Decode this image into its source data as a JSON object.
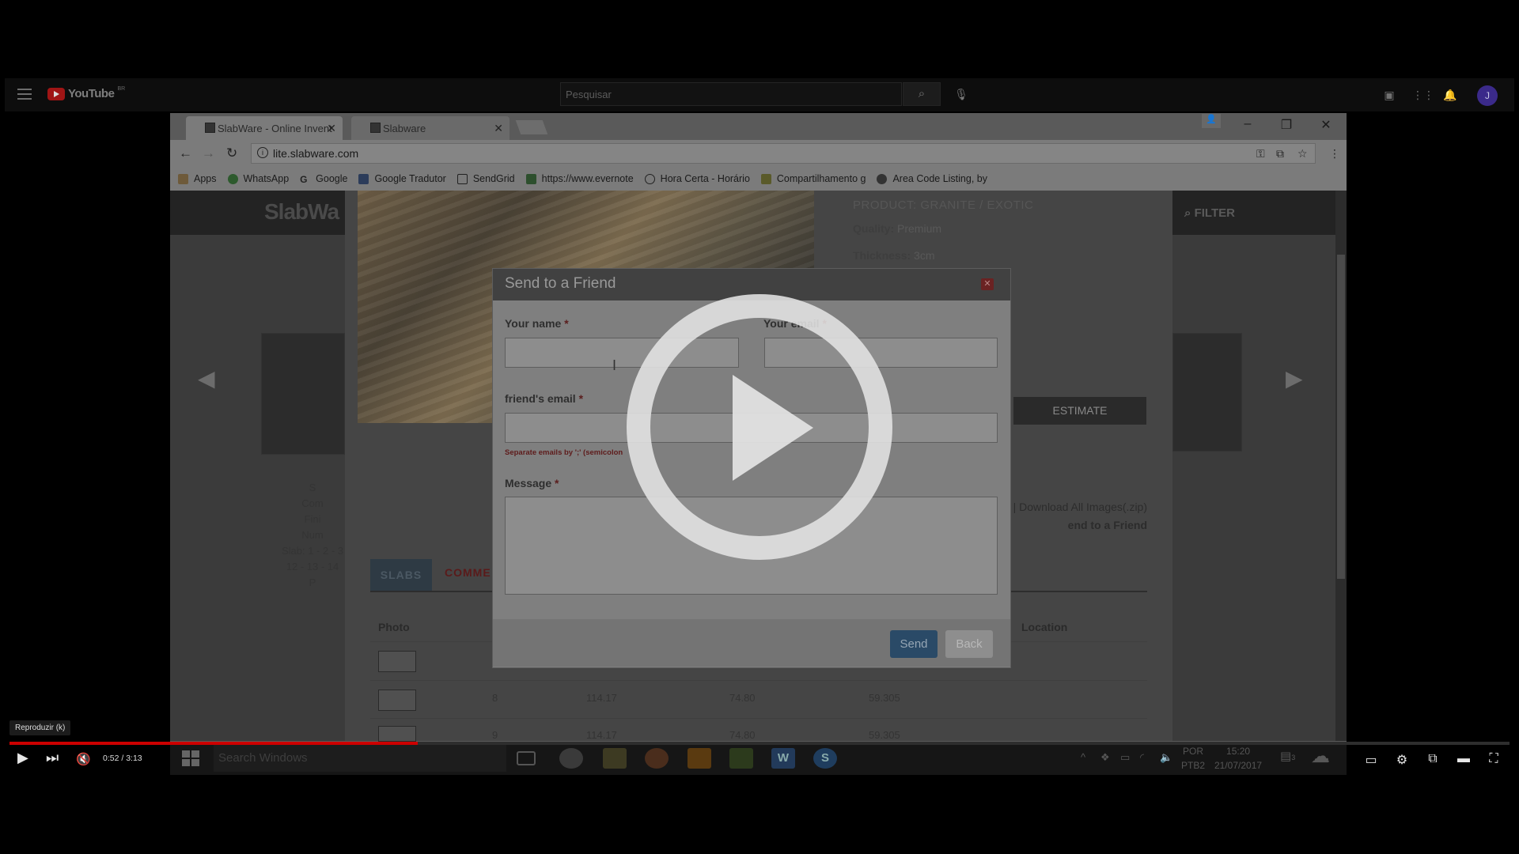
{
  "youtube": {
    "logo": "YouTube",
    "region": "BR",
    "search_placeholder": "Pesquisar",
    "avatar_letter": "J"
  },
  "browser": {
    "tabs": [
      {
        "label": "SlabWare - Online Invent"
      },
      {
        "label": "Slabware"
      }
    ],
    "url": "lite.slabware.com",
    "bookmarks": [
      {
        "label": "Apps"
      },
      {
        "label": "WhatsApp"
      },
      {
        "label": "Google"
      },
      {
        "label": "Google Tradutor"
      },
      {
        "label": "SendGrid"
      },
      {
        "label": "https://www.evernote"
      },
      {
        "label": "Hora Certa - Horário"
      },
      {
        "label": "Compartilhamento g"
      },
      {
        "label": "Area Code Listing, by"
      }
    ]
  },
  "page": {
    "logo": "SlabWa",
    "filter": "FILTER",
    "product_title": "PRODUCT: GRANITE / EXOTIC",
    "quality_label": "Quality:",
    "quality_value": "Premium",
    "thickness_label": "Thickness:",
    "thickness_value": "3cm",
    "estimate": "ESTIMATE",
    "download_all": "| Download All Images(.zip)",
    "send_to_friend": "end to a Friend",
    "left_meta": [
      "S",
      "Com",
      "Fini",
      "Num",
      "Slab: 1 - 2 - 3",
      "12 - 13 - 14",
      "P"
    ],
    "tabs": {
      "slabs": "SLABS",
      "comments": "COMME"
    },
    "table": {
      "headers": {
        "photo": "Photo",
        "location": "Location"
      },
      "rows": [
        {
          "num": "",
          "length": "",
          "width": "",
          "area": ""
        },
        {
          "num": "8",
          "length": "114.17",
          "width": "74.80",
          "area": "59.305"
        },
        {
          "num": "9",
          "length": "114.17",
          "width": "74.80",
          "area": "59.305"
        }
      ]
    }
  },
  "modal": {
    "title": "Send to a Friend",
    "your_name_label": "Your name",
    "your_email_label": "Your email",
    "friends_email_label": "friend's email",
    "separator_note": "Separate emails by ';' (semicolon",
    "message_label": "Message",
    "required_mark": "*",
    "send": "Send",
    "back": "Back"
  },
  "taskbar": {
    "search_placeholder": "Search Windows",
    "lang_1": "POR",
    "lang_2": "PTB2",
    "time": "15:20",
    "date": "21/07/2017",
    "notification_count": "3"
  },
  "player": {
    "tooltip": "Reproduzir (k)",
    "current_time": "0:52",
    "duration": "3:13",
    "time_display": "0:52 / 3:13",
    "progress": 0.272,
    "accent": "#cc0000"
  }
}
